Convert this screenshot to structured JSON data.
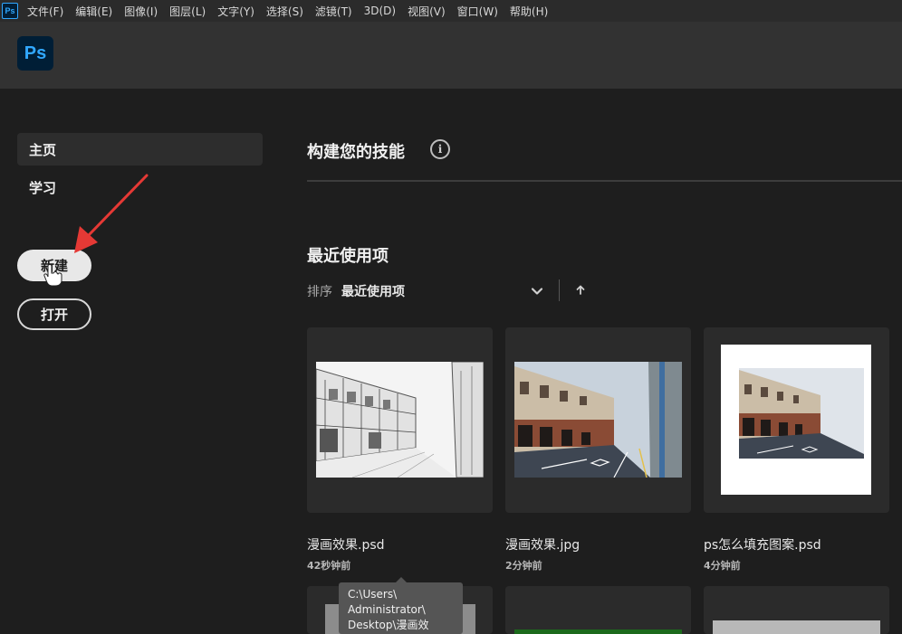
{
  "menubar": {
    "app_icon": "Ps",
    "items": [
      "文件(F)",
      "编辑(E)",
      "图像(I)",
      "图层(L)",
      "文字(Y)",
      "选择(S)",
      "滤镜(T)",
      "3D(D)",
      "视图(V)",
      "窗口(W)",
      "帮助(H)"
    ]
  },
  "header": {
    "logo": "Ps"
  },
  "sidebar": {
    "items": [
      {
        "label": "主页",
        "active": true
      },
      {
        "label": "学习",
        "active": false
      }
    ],
    "new_button": "新建",
    "open_button": "打开"
  },
  "main": {
    "skills_title": "构建您的技能",
    "info_icon": "i",
    "recent_title": "最近使用项",
    "sort_label": "排序",
    "sort_value": "最近使用项",
    "files": [
      {
        "name": "漫画效果.psd",
        "time": "42秒钟前"
      },
      {
        "name": "漫画效果.jpg",
        "time": "2分钟前"
      },
      {
        "name": "ps怎么填充图案.psd",
        "time": "4分钟前"
      }
    ],
    "tooltip": {
      "lines": [
        "C:\\Users\\",
        "Administrator\\",
        "Desktop\\漫画效"
      ]
    }
  },
  "colors": {
    "background": "#1e1e1e",
    "header": "#323232",
    "ps_blue": "#31a8ff",
    "annotation_red": "#e53935"
  }
}
